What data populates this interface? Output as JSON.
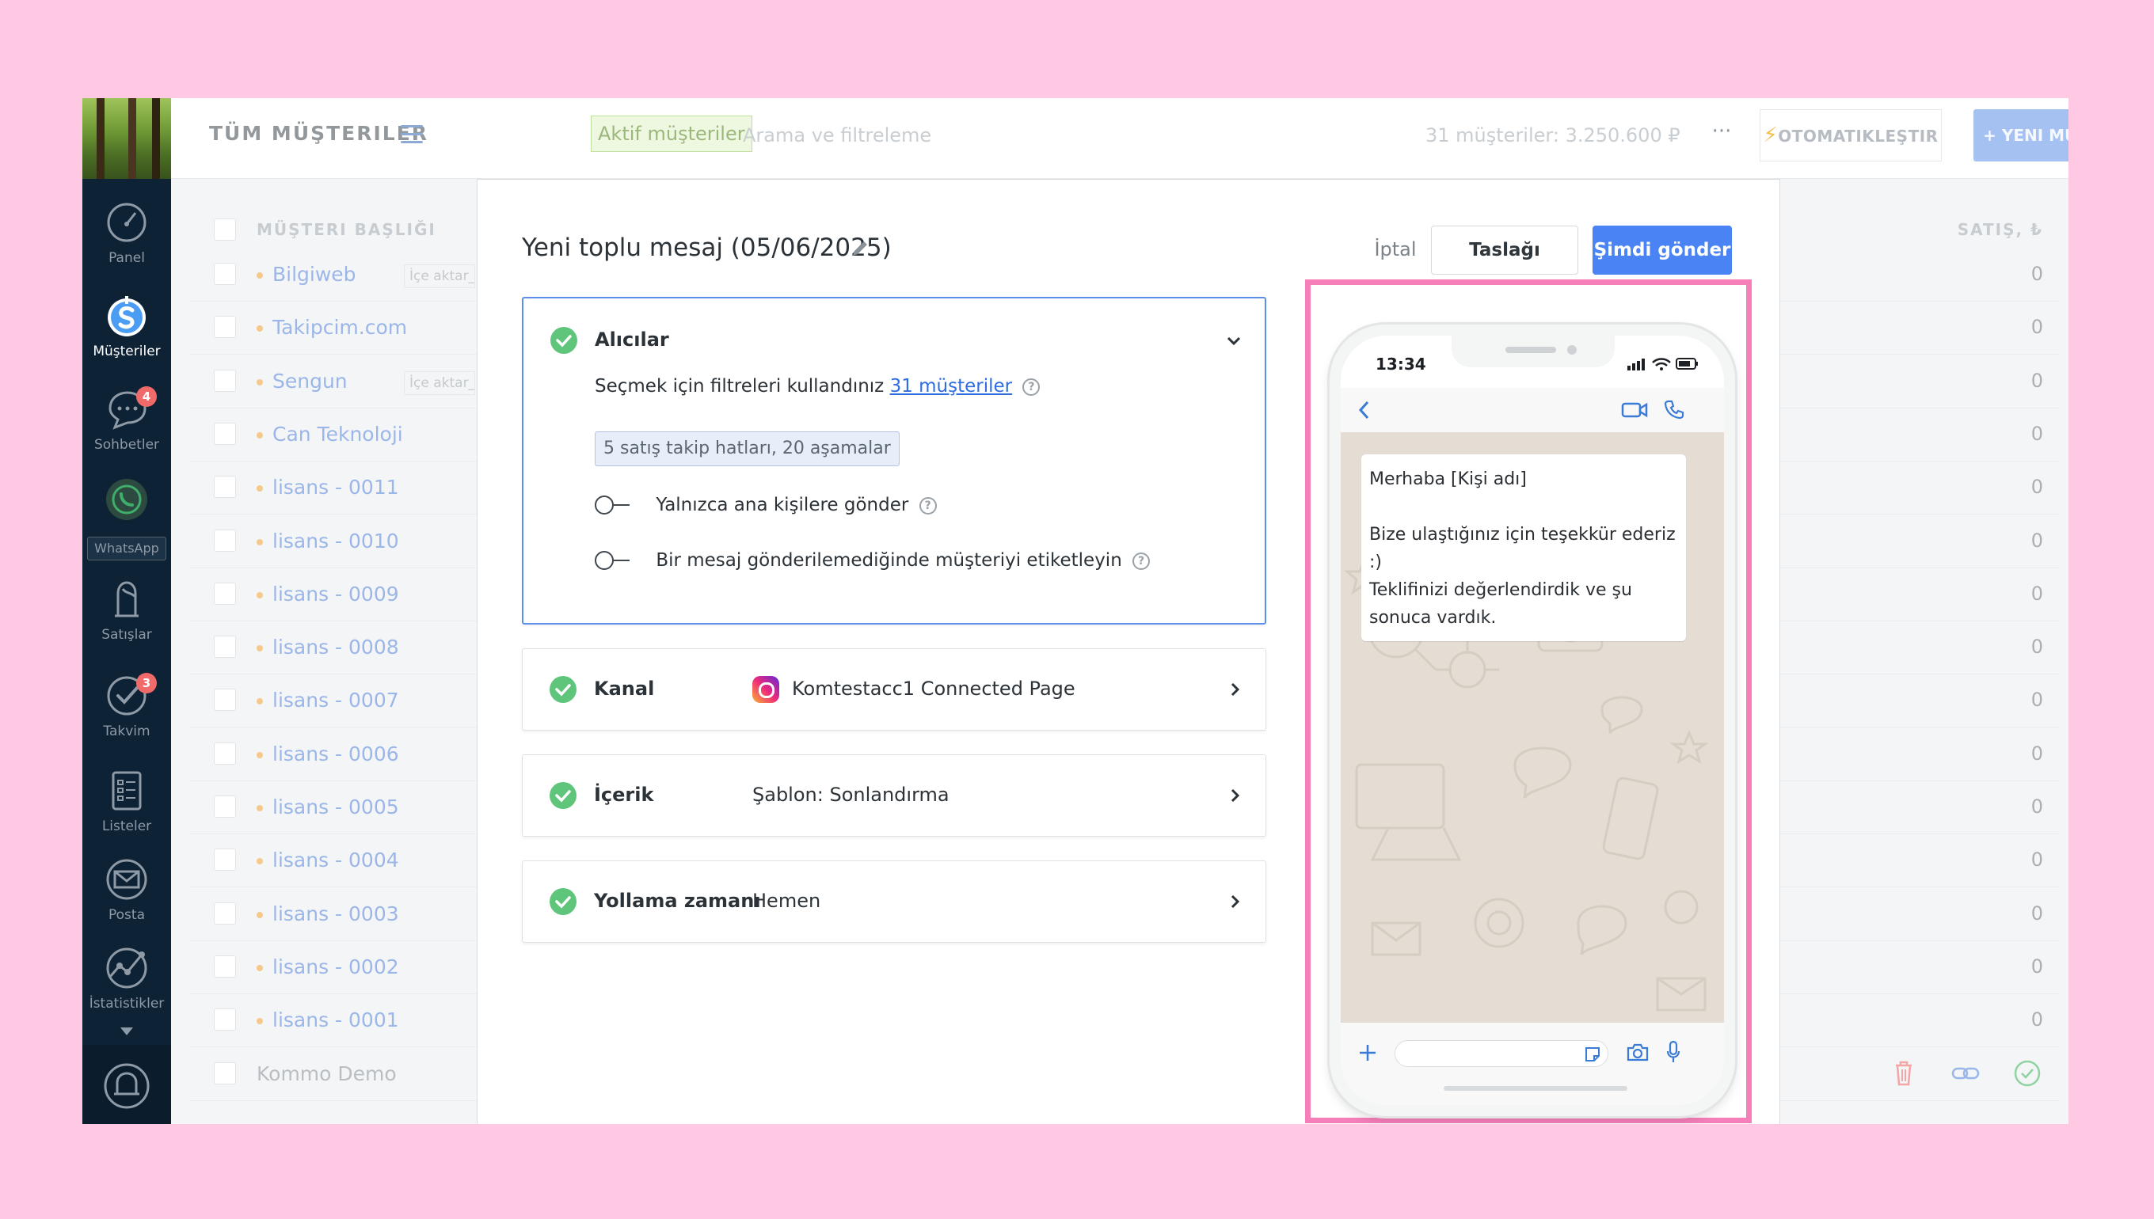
{
  "sidebar": {
    "items": [
      {
        "label": "Panel",
        "icon": "gauge-icon"
      },
      {
        "label": "Müşteriler",
        "icon": "money-icon"
      },
      {
        "label": "Sohbetler",
        "icon": "chat-icon",
        "badge": "4"
      },
      {
        "label": "WhatsApp",
        "icon": "whatsapp-icon"
      },
      {
        "label": "Satışlar",
        "icon": "handshake-icon"
      },
      {
        "label": "Takvim",
        "icon": "checkmark-icon",
        "badge": "3"
      },
      {
        "label": "Listeler",
        "icon": "list-icon"
      },
      {
        "label": "Posta",
        "icon": "mail-icon"
      },
      {
        "label": "İstatistikler",
        "icon": "stats-icon"
      }
    ]
  },
  "header": {
    "title": "TÜM MÜŞTERILER",
    "filter_tag": "Aktif müşteriler",
    "search_placeholder": "Arama ve filtreleme",
    "customers_count": "31 müşteriler: 3.250.600 ₽",
    "more_label": "···",
    "automate_label": "OTOMATIKLEŞTIR",
    "new_customer_label": "+ YENI MÜŞTERI"
  },
  "list": {
    "col_title": "MÜŞTERI BAŞLIĞI",
    "col_sales": "SATIŞ, ₺",
    "rows": [
      {
        "name": "Bilgiweb",
        "tag": "İçe aktar_",
        "sale": "0"
      },
      {
        "name": "Takipcim.com",
        "tag": "",
        "sale": "0"
      },
      {
        "name": "Sengun",
        "tag": "İçe aktar_",
        "sale": "0"
      },
      {
        "name": "Can Teknoloji",
        "tag": "",
        "sale": "0"
      },
      {
        "name": "lisans - 0011",
        "tag": "",
        "sale": "0"
      },
      {
        "name": "lisans - 0010",
        "tag": "",
        "sale": "0"
      },
      {
        "name": "lisans - 0009",
        "tag": "",
        "sale": "0"
      },
      {
        "name": "lisans - 0008",
        "tag": "",
        "sale": "0"
      },
      {
        "name": "lisans - 0007",
        "tag": "",
        "sale": "0"
      },
      {
        "name": "lisans - 0006",
        "tag": "",
        "sale": "0"
      },
      {
        "name": "lisans - 0005",
        "tag": "",
        "sale": "0"
      },
      {
        "name": "lisans - 0004",
        "tag": "",
        "sale": "0"
      },
      {
        "name": "lisans - 0003",
        "tag": "",
        "sale": "0"
      },
      {
        "name": "lisans - 0002",
        "tag": "",
        "sale": "0"
      },
      {
        "name": "lisans - 0001",
        "tag": "",
        "sale": "0"
      }
    ],
    "demo_row": "Kommo Demo"
  },
  "modal": {
    "title": "Yeni toplu mesaj (05/06/2025)",
    "cancel_label": "İptal",
    "draft_label": "Taslağı kaydet",
    "send_label": "Şimdi gönder",
    "recipients": {
      "title": "Alıcılar",
      "desc": "Seçmek için filtreleri kullandınız",
      "link": "31 müşteriler",
      "pipeline_chip": "5 satış takip hatları, 20 aşamalar",
      "toggle_main_contacts": "Yalnızca ana kişilere gönder",
      "toggle_tag_failed": "Bir mesaj gönderilemediğinde müşteriyi etiketleyin"
    },
    "channel": {
      "title": "Kanal",
      "value": "Komtestacc1 Connected Page"
    },
    "content": {
      "title": "İçerik",
      "value": "Şablon: Sonlandırma"
    },
    "schedule": {
      "title": "Yollama zamanı",
      "value": "Hemen"
    }
  },
  "preview": {
    "status_time": "13:34",
    "message_lines": [
      "Merhaba [Kişi adı]",
      "",
      "Bize ulaştığınız için teşekkür ederiz",
      ":)",
      "Teklifinizi değerlendirdik ve şu",
      "sonuca vardık."
    ]
  },
  "colors": {
    "background_pink": "#ffc9e3",
    "highlight_border": "#f67fba",
    "primary_blue": "#4a84f4",
    "success_green": "#5ec57b",
    "sidebar_dark": "#0e2235"
  }
}
